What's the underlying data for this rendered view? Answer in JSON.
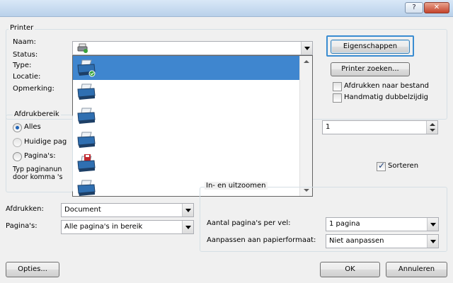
{
  "titlebar": {
    "help_label": "?",
    "close_label": "✕"
  },
  "printer": {
    "group_label": "Printer",
    "name_label": "Naam:",
    "status_label": "Status:",
    "type_label": "Type:",
    "location_label": "Locatie:",
    "comment_label": "Opmerking:",
    "properties_button": "Eigenschappen",
    "find_printer_button": "Printer zoeken...",
    "print_to_file_label": "Afdrukken naar bestand",
    "manual_duplex_label": "Handmatig dubbelzijdig",
    "print_to_file_checked": false,
    "manual_duplex_checked": false
  },
  "printer_list": {
    "items": [
      {
        "icon": "printer-icon",
        "selected": true
      },
      {
        "icon": "printer-icon",
        "selected": false
      },
      {
        "icon": "printer-icon",
        "selected": false
      },
      {
        "icon": "printer-icon",
        "selected": false
      },
      {
        "icon": "fax-printer-icon",
        "selected": false
      },
      {
        "icon": "printer-icon",
        "selected": false
      }
    ]
  },
  "range": {
    "group_label": "Afdrukbereik",
    "all_label": "Alles",
    "current_page_label": "Huidige pag",
    "pages_label": "Pagina's:",
    "hint_line1": "Typ paginanun",
    "hint_line2": "door komma 's",
    "selected": "all"
  },
  "copies": {
    "count": "1",
    "collate_label": "Sorteren",
    "collate_checked": true
  },
  "print_what": {
    "label": "Afdrukken:",
    "value": "Document"
  },
  "print_pages": {
    "label": "Pagina's:",
    "value": "Alle pagina's in bereik"
  },
  "zoom": {
    "group_label": "In- en uitzoomen",
    "pages_per_sheet_label": "Aantal pagina's per vel:",
    "pages_per_sheet_value": "1 pagina",
    "scale_label": "Aanpassen aan papierformaat:",
    "scale_value": "Niet aanpassen"
  },
  "footer": {
    "options_button": "Opties...",
    "ok_button": "OK",
    "cancel_button": "Annuleren"
  },
  "colors": {
    "selection": "#3f86cf",
    "focus_border": "#3a8cd1",
    "dialog_bg": "#f0f0f0"
  }
}
